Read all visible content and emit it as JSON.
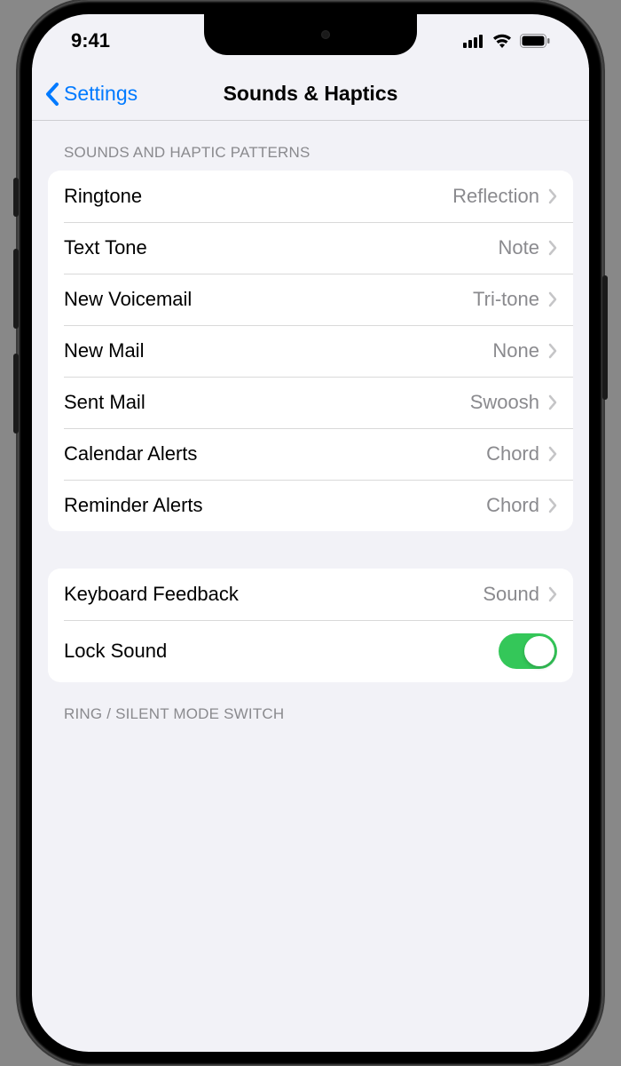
{
  "statusBar": {
    "time": "9:41"
  },
  "nav": {
    "back": "Settings",
    "title": "Sounds & Haptics"
  },
  "section1": {
    "header": "SOUNDS AND HAPTIC PATTERNS",
    "rows": [
      {
        "label": "Ringtone",
        "value": "Reflection"
      },
      {
        "label": "Text Tone",
        "value": "Note"
      },
      {
        "label": "New Voicemail",
        "value": "Tri-tone"
      },
      {
        "label": "New Mail",
        "value": "None"
      },
      {
        "label": "Sent Mail",
        "value": "Swoosh"
      },
      {
        "label": "Calendar Alerts",
        "value": "Chord"
      },
      {
        "label": "Reminder Alerts",
        "value": "Chord"
      }
    ]
  },
  "section2": {
    "rows": [
      {
        "label": "Keyboard Feedback",
        "value": "Sound"
      },
      {
        "label": "Lock Sound",
        "toggle": true
      }
    ]
  },
  "section3": {
    "header": "RING / SILENT MODE SWITCH"
  }
}
